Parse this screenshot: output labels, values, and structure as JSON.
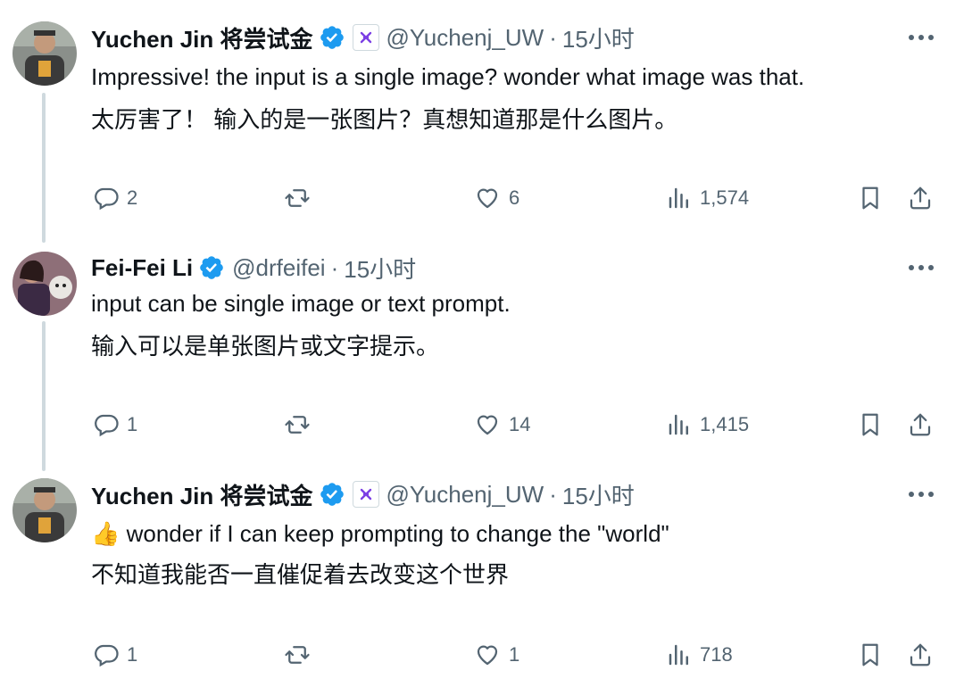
{
  "tweets": [
    {
      "name": "Yuchen Jin 将尝试金",
      "handle": "@Yuchenj_UW",
      "separator": "·",
      "time": "15小时",
      "affiliate_badge": true,
      "lines": [
        "Impressive! the input is a single image? wonder what image was that.",
        "太厉害了！ 输入的是一张图片？真想知道那是什么图片。"
      ],
      "emoji": "",
      "replies": "2",
      "retweets": "",
      "likes": "6",
      "views": "1,574"
    },
    {
      "name": "Fei-Fei Li",
      "handle": "@drfeifei",
      "separator": "·",
      "time": "15小时",
      "affiliate_badge": false,
      "lines": [
        "input can be single image or text prompt.",
        "输入可以是单张图片或文字提示。"
      ],
      "emoji": "",
      "replies": "1",
      "retweets": "",
      "likes": "14",
      "views": "1,415"
    },
    {
      "name": "Yuchen Jin 将尝试金",
      "handle": "@Yuchenj_UW",
      "separator": "·",
      "time": "15小时",
      "affiliate_badge": true,
      "lines": [
        "wonder if I can keep prompting to change the \"world\"",
        "不知道我能否一直催促着去改变这个世界"
      ],
      "emoji": "👍",
      "replies": "1",
      "retweets": "",
      "likes": "1",
      "views": "718"
    }
  ],
  "colors": {
    "text": "#0f1419",
    "secondary": "#536471",
    "verified": "#1d9bf0",
    "thread_line": "#cfd9de"
  },
  "icons": {
    "reply": "speech-bubble-icon",
    "retweet": "retweet-arrows-icon",
    "like": "heart-icon",
    "views": "bar-chart-icon",
    "bookmark": "bookmark-icon",
    "share": "share-upload-icon",
    "more": "ellipsis-icon",
    "verified": "verified-badge-icon",
    "affiliate": "affiliate-badge-icon"
  }
}
